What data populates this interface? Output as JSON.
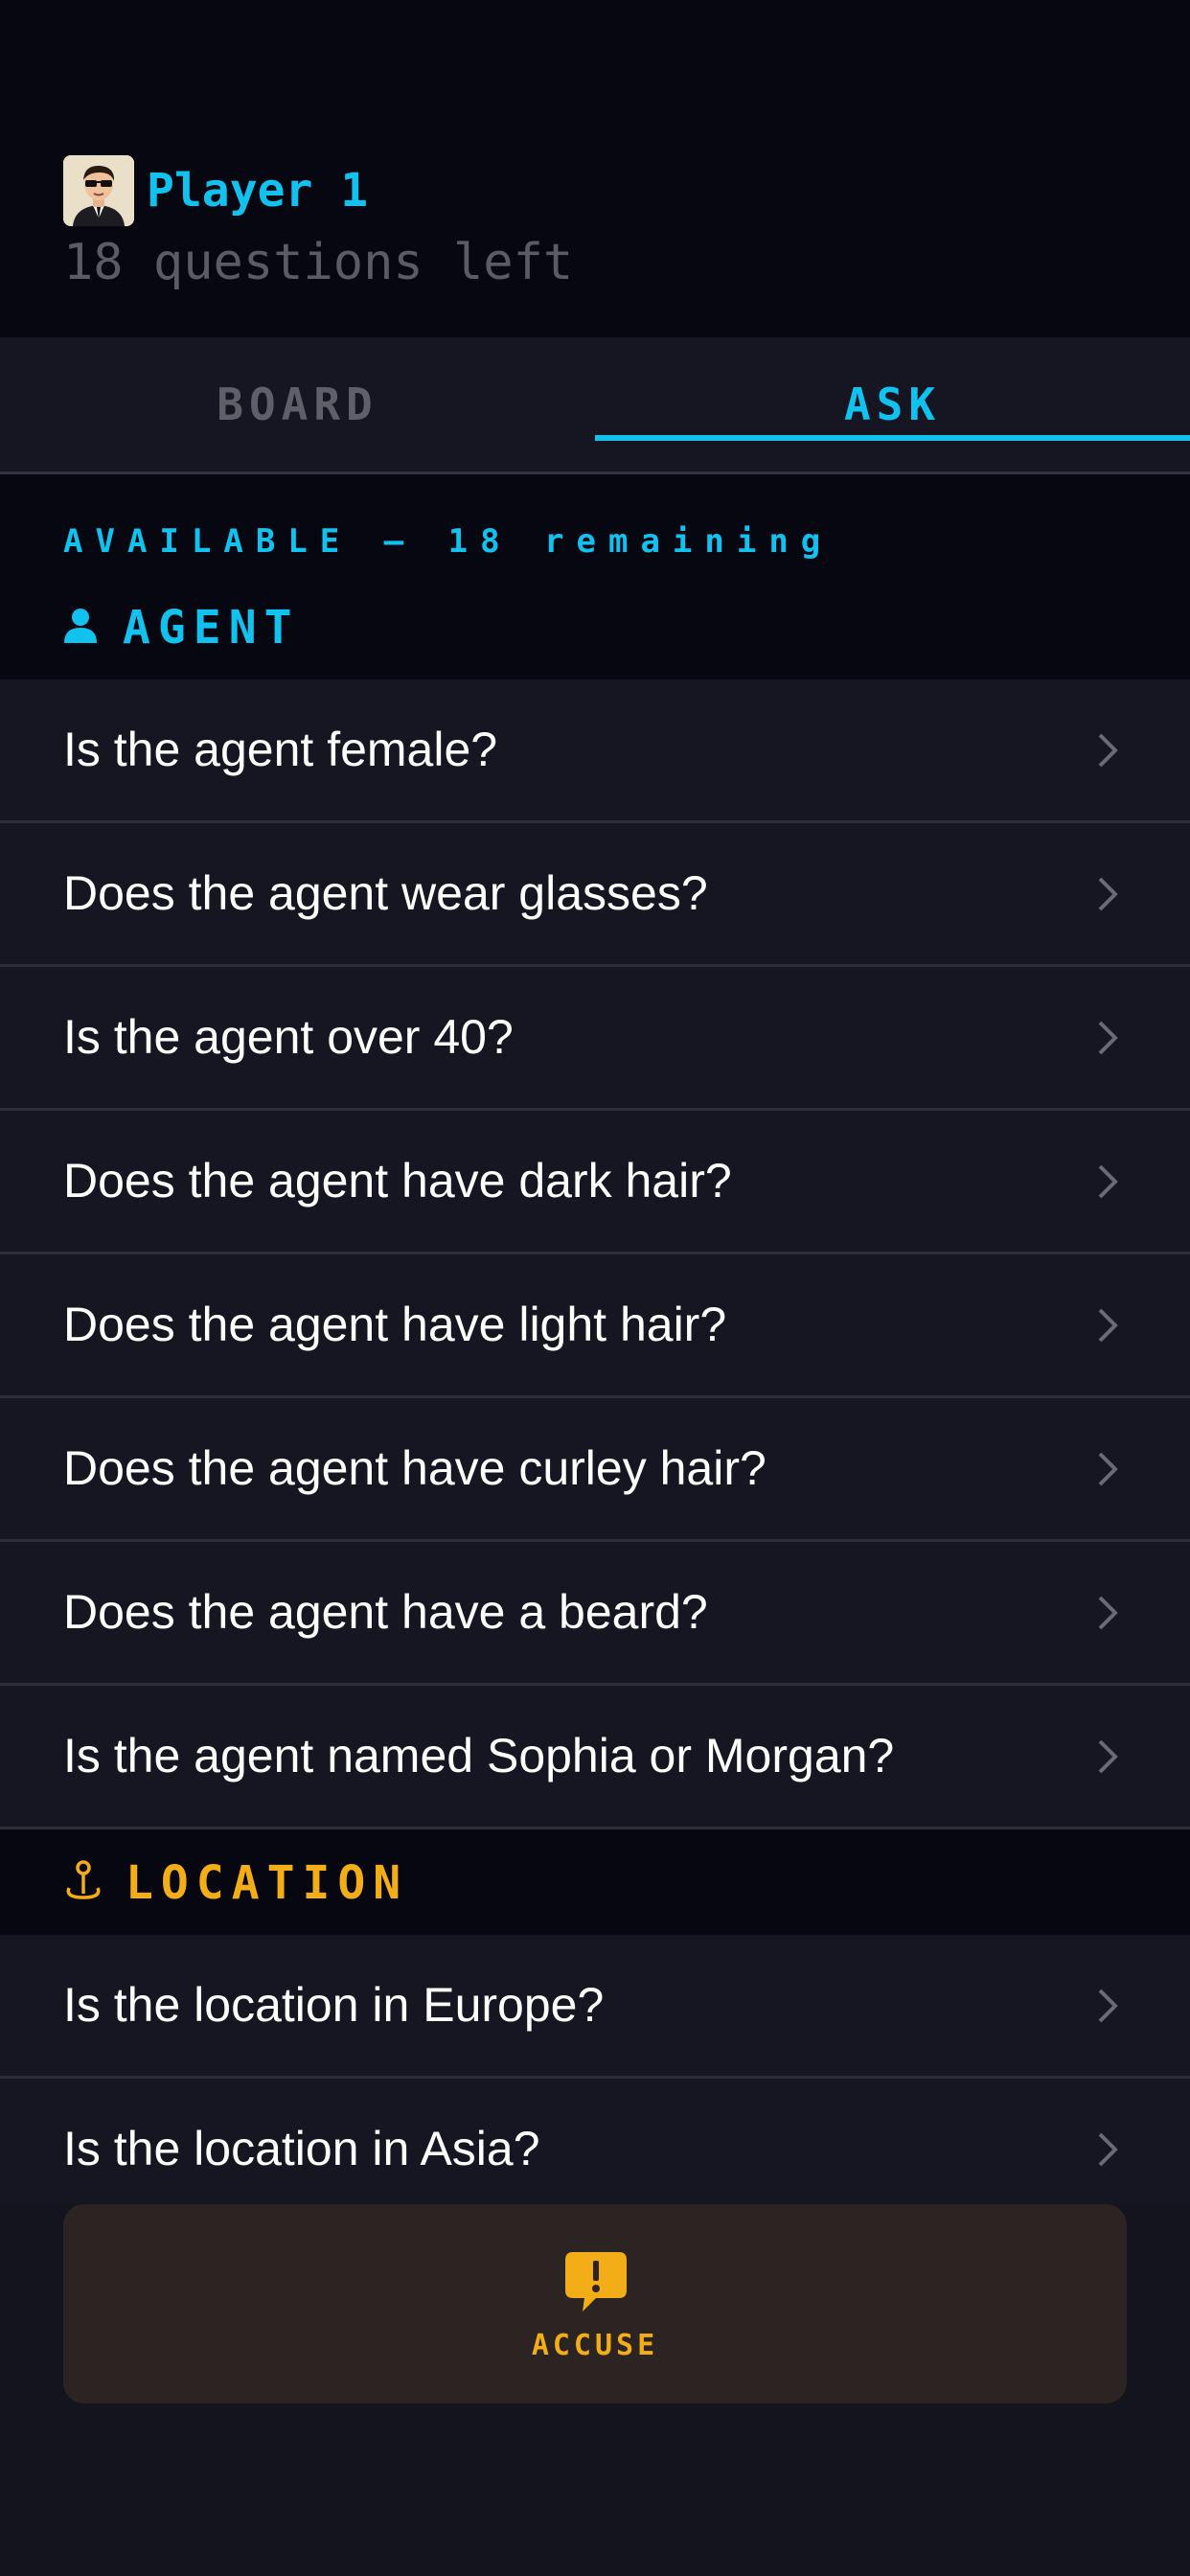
{
  "header": {
    "player_name": "Player 1",
    "questions_left": "18 questions left"
  },
  "tabs": [
    {
      "label": "BOARD",
      "active": false
    },
    {
      "label": "ASK",
      "active": true
    }
  ],
  "available_label": "AVAILABLE — 18 remaining",
  "sections": {
    "agent": {
      "title": "AGENT",
      "icon": "person-icon",
      "color": "#12c2ee",
      "questions": [
        "Is the agent female?",
        "Does the agent wear glasses?",
        "Is the agent over 40?",
        "Does the agent have dark hair?",
        "Does the agent have light hair?",
        "Does the agent have curley hair?",
        "Does the agent have a beard?",
        "Is the agent named Sophia or Morgan?"
      ]
    },
    "location": {
      "title": "LOCATION",
      "icon": "location-pin-icon",
      "color": "#f2ad17",
      "questions": [
        "Is the location in Europe?",
        "Is the location in Asia?"
      ]
    }
  },
  "accuse": {
    "label": "ACCUSE",
    "icon": "exclamation-bubble-icon"
  },
  "colors": {
    "accent": "#12c2ee",
    "warning": "#f2ad17",
    "background": "#14141f"
  }
}
